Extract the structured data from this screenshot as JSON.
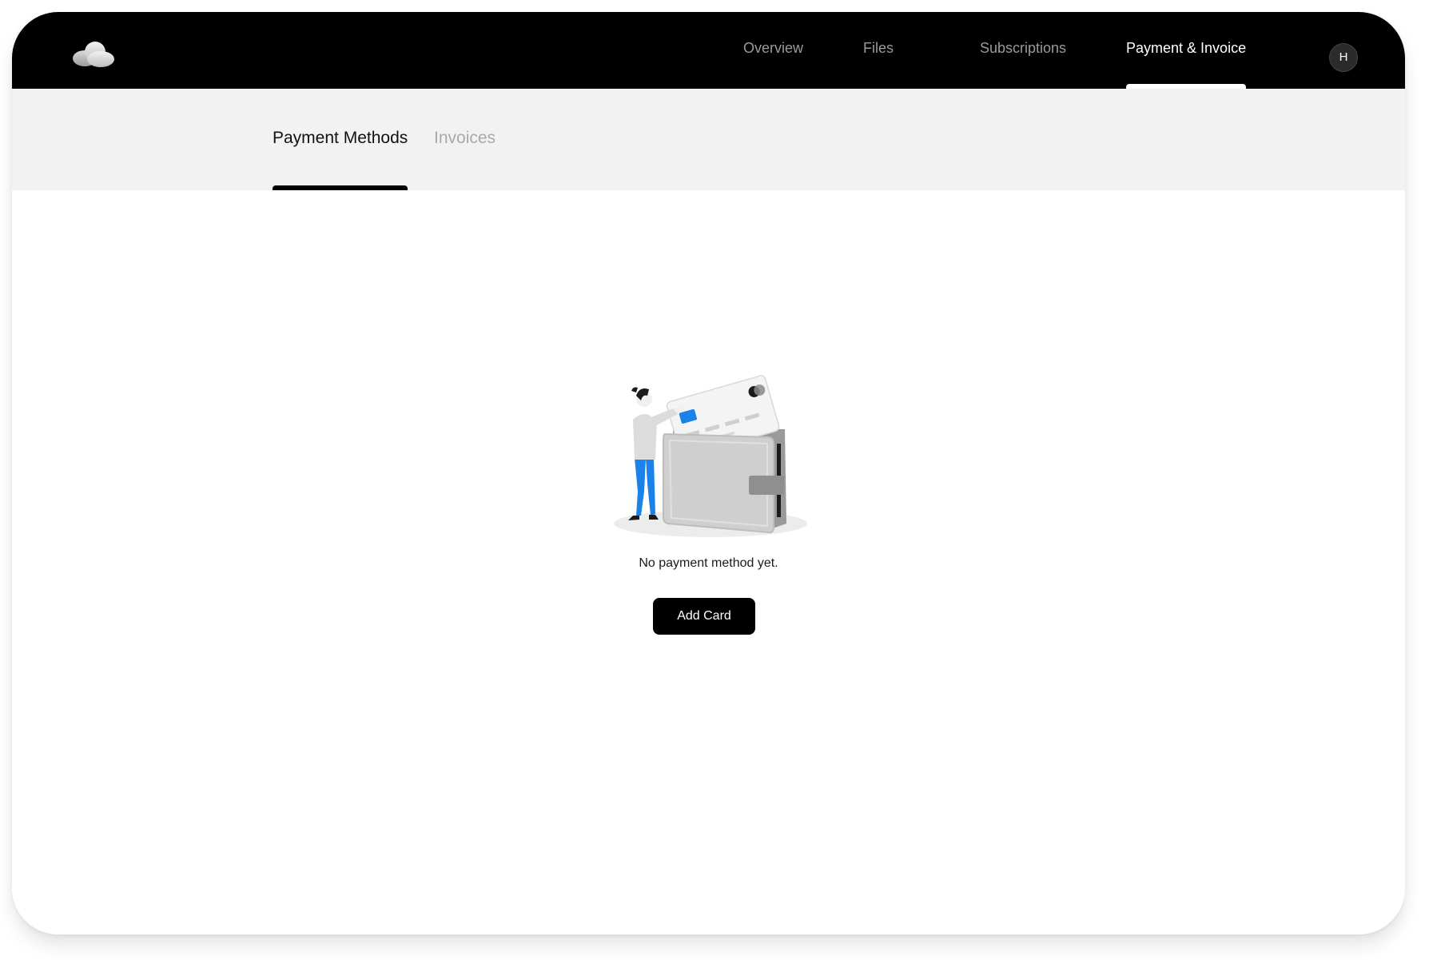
{
  "header": {
    "logo_icon": "cloud-icon",
    "nav": [
      {
        "label": "Overview"
      },
      {
        "label": "Files"
      },
      {
        "label": "Subscriptions"
      },
      {
        "label": "Payment & Invoice"
      }
    ],
    "avatar_initial": "H"
  },
  "subnav": {
    "tabs": [
      {
        "label": "Payment Methods"
      },
      {
        "label": "Invoices"
      }
    ]
  },
  "empty_state": {
    "illustration": "person-adding-card-to-wallet-illustration",
    "message": "No payment method yet.",
    "button_label": "Add Card"
  },
  "colors": {
    "topbar": "#000000",
    "subbar": "#f2f2f2",
    "accent_blue": "#1a82e8",
    "button": "#000000"
  }
}
